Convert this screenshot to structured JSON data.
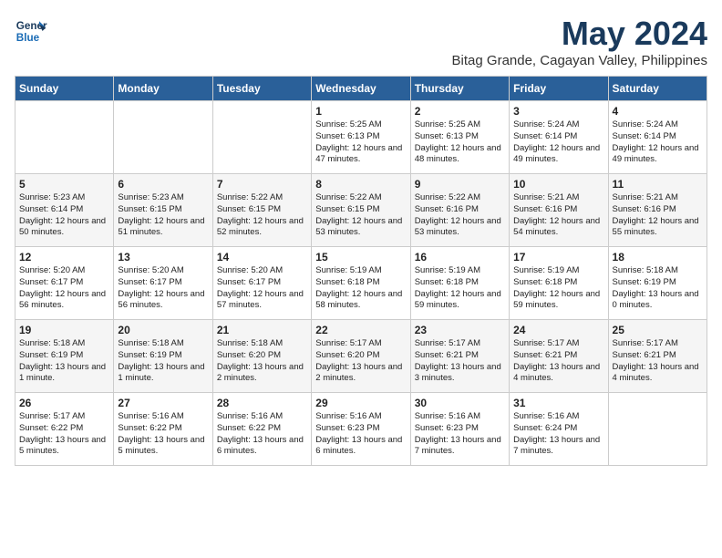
{
  "header": {
    "logo_line1": "General",
    "logo_line2": "Blue",
    "month": "May 2024",
    "location": "Bitag Grande, Cagayan Valley, Philippines"
  },
  "days_of_week": [
    "Sunday",
    "Monday",
    "Tuesday",
    "Wednesday",
    "Thursday",
    "Friday",
    "Saturday"
  ],
  "weeks": [
    [
      {
        "day": "",
        "text": ""
      },
      {
        "day": "",
        "text": ""
      },
      {
        "day": "",
        "text": ""
      },
      {
        "day": "1",
        "text": "Sunrise: 5:25 AM\nSunset: 6:13 PM\nDaylight: 12 hours and 47 minutes."
      },
      {
        "day": "2",
        "text": "Sunrise: 5:25 AM\nSunset: 6:13 PM\nDaylight: 12 hours and 48 minutes."
      },
      {
        "day": "3",
        "text": "Sunrise: 5:24 AM\nSunset: 6:14 PM\nDaylight: 12 hours and 49 minutes."
      },
      {
        "day": "4",
        "text": "Sunrise: 5:24 AM\nSunset: 6:14 PM\nDaylight: 12 hours and 49 minutes."
      }
    ],
    [
      {
        "day": "5",
        "text": "Sunrise: 5:23 AM\nSunset: 6:14 PM\nDaylight: 12 hours and 50 minutes."
      },
      {
        "day": "6",
        "text": "Sunrise: 5:23 AM\nSunset: 6:15 PM\nDaylight: 12 hours and 51 minutes."
      },
      {
        "day": "7",
        "text": "Sunrise: 5:22 AM\nSunset: 6:15 PM\nDaylight: 12 hours and 52 minutes."
      },
      {
        "day": "8",
        "text": "Sunrise: 5:22 AM\nSunset: 6:15 PM\nDaylight: 12 hours and 53 minutes."
      },
      {
        "day": "9",
        "text": "Sunrise: 5:22 AM\nSunset: 6:16 PM\nDaylight: 12 hours and 53 minutes."
      },
      {
        "day": "10",
        "text": "Sunrise: 5:21 AM\nSunset: 6:16 PM\nDaylight: 12 hours and 54 minutes."
      },
      {
        "day": "11",
        "text": "Sunrise: 5:21 AM\nSunset: 6:16 PM\nDaylight: 12 hours and 55 minutes."
      }
    ],
    [
      {
        "day": "12",
        "text": "Sunrise: 5:20 AM\nSunset: 6:17 PM\nDaylight: 12 hours and 56 minutes."
      },
      {
        "day": "13",
        "text": "Sunrise: 5:20 AM\nSunset: 6:17 PM\nDaylight: 12 hours and 56 minutes."
      },
      {
        "day": "14",
        "text": "Sunrise: 5:20 AM\nSunset: 6:17 PM\nDaylight: 12 hours and 57 minutes."
      },
      {
        "day": "15",
        "text": "Sunrise: 5:19 AM\nSunset: 6:18 PM\nDaylight: 12 hours and 58 minutes."
      },
      {
        "day": "16",
        "text": "Sunrise: 5:19 AM\nSunset: 6:18 PM\nDaylight: 12 hours and 59 minutes."
      },
      {
        "day": "17",
        "text": "Sunrise: 5:19 AM\nSunset: 6:18 PM\nDaylight: 12 hours and 59 minutes."
      },
      {
        "day": "18",
        "text": "Sunrise: 5:18 AM\nSunset: 6:19 PM\nDaylight: 13 hours and 0 minutes."
      }
    ],
    [
      {
        "day": "19",
        "text": "Sunrise: 5:18 AM\nSunset: 6:19 PM\nDaylight: 13 hours and 1 minute."
      },
      {
        "day": "20",
        "text": "Sunrise: 5:18 AM\nSunset: 6:19 PM\nDaylight: 13 hours and 1 minute."
      },
      {
        "day": "21",
        "text": "Sunrise: 5:18 AM\nSunset: 6:20 PM\nDaylight: 13 hours and 2 minutes."
      },
      {
        "day": "22",
        "text": "Sunrise: 5:17 AM\nSunset: 6:20 PM\nDaylight: 13 hours and 2 minutes."
      },
      {
        "day": "23",
        "text": "Sunrise: 5:17 AM\nSunset: 6:21 PM\nDaylight: 13 hours and 3 minutes."
      },
      {
        "day": "24",
        "text": "Sunrise: 5:17 AM\nSunset: 6:21 PM\nDaylight: 13 hours and 4 minutes."
      },
      {
        "day": "25",
        "text": "Sunrise: 5:17 AM\nSunset: 6:21 PM\nDaylight: 13 hours and 4 minutes."
      }
    ],
    [
      {
        "day": "26",
        "text": "Sunrise: 5:17 AM\nSunset: 6:22 PM\nDaylight: 13 hours and 5 minutes."
      },
      {
        "day": "27",
        "text": "Sunrise: 5:16 AM\nSunset: 6:22 PM\nDaylight: 13 hours and 5 minutes."
      },
      {
        "day": "28",
        "text": "Sunrise: 5:16 AM\nSunset: 6:22 PM\nDaylight: 13 hours and 6 minutes."
      },
      {
        "day": "29",
        "text": "Sunrise: 5:16 AM\nSunset: 6:23 PM\nDaylight: 13 hours and 6 minutes."
      },
      {
        "day": "30",
        "text": "Sunrise: 5:16 AM\nSunset: 6:23 PM\nDaylight: 13 hours and 7 minutes."
      },
      {
        "day": "31",
        "text": "Sunrise: 5:16 AM\nSunset: 6:24 PM\nDaylight: 13 hours and 7 minutes."
      },
      {
        "day": "",
        "text": ""
      }
    ]
  ]
}
